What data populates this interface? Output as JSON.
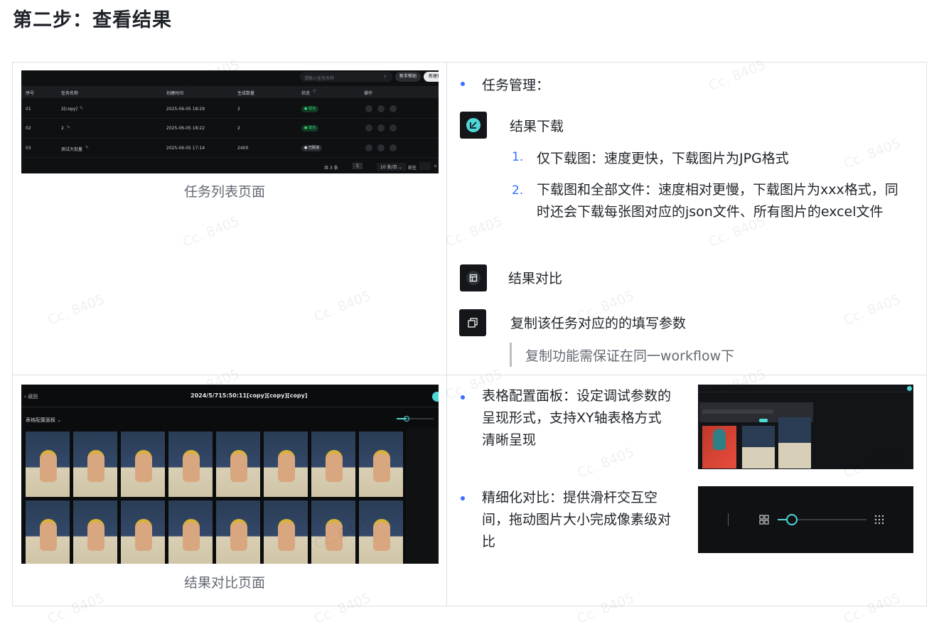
{
  "title": "第二步：查看结果",
  "watermark": "Cc. 8405",
  "task_list": {
    "caption": "任务列表页面",
    "search_placeholder": "请输入任务名称",
    "help_btn": "新手帮助",
    "new_btn": "新建批量任务",
    "headers": [
      "序号",
      "任务名称",
      "创建时间",
      "生成数量",
      "状态",
      "操作"
    ],
    "rows": [
      {
        "id": "01",
        "name": "2[copy]",
        "time": "2025-06-05 18:29",
        "count": "2",
        "status": "成功"
      },
      {
        "id": "02",
        "name": "2",
        "time": "2025-06-05 18:22",
        "count": "2",
        "status": "成功"
      },
      {
        "id": "03",
        "name": "测试大批量",
        "time": "2025-06-05 17:14",
        "count": "2400",
        "status": "已取消"
      }
    ],
    "total": "共 3 条",
    "page": "1",
    "page_size": "10 条/页",
    "goto": "前往"
  },
  "task_mgmt": {
    "heading": "任务管理：",
    "download": {
      "label": "结果下载",
      "items": [
        {
          "num": "1.",
          "text": "仅下载图：速度更快，下载图片为JPG格式"
        },
        {
          "num": "2.",
          "text": "下载图和全部文件：速度相对更慢，下载图片为xxx格式，同时还会下载每张图对应的json文件、所有图片的excel文件"
        }
      ]
    },
    "compare": {
      "label": "结果对比"
    },
    "copy": {
      "label": "复制该任务对应的的填写参数",
      "quote": "复制功能需保证在同一workflow下"
    }
  },
  "compare_page": {
    "caption": "结果对比页面",
    "back": "返回",
    "page_title": "2024/5/715:50:11[copy][copy][copy]",
    "panel_label": "表格配置面板"
  },
  "features": [
    {
      "text": "表格配置面板：设定调试参数的呈现形式，支持XY轴表格方式清晰呈现"
    },
    {
      "text": "精细化对比：提供滑杆交互空间，拖动图片大小完成像素级对比"
    }
  ],
  "colors": {
    "accent": "#3370ff",
    "success": "#3fd17a",
    "slider": "#4fd8d8"
  }
}
